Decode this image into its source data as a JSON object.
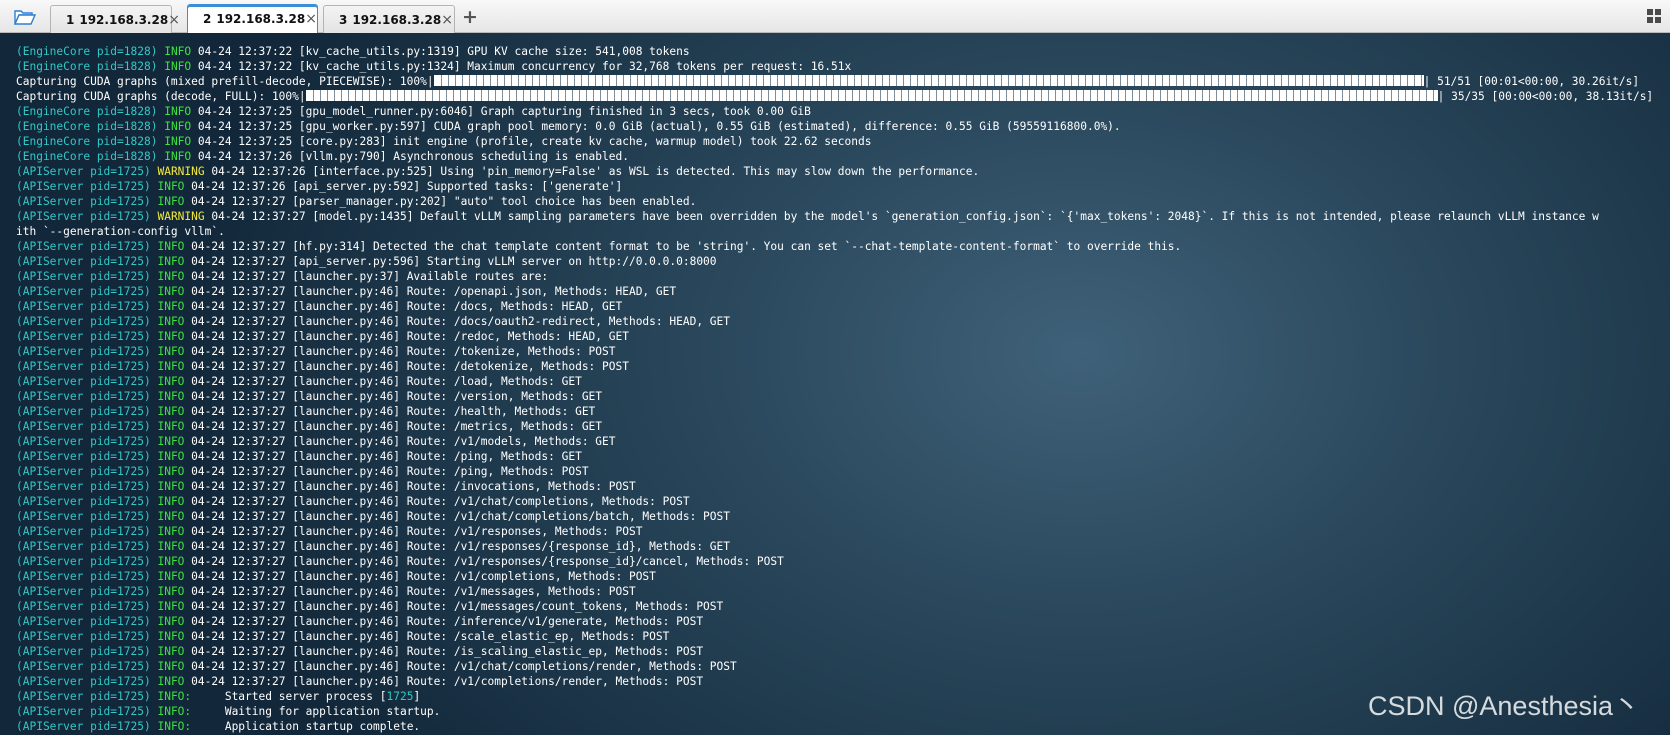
{
  "tabs": [
    {
      "number": "1",
      "host": "192.168.3.28",
      "active": false,
      "status_color": "#22c322"
    },
    {
      "number": "2",
      "host": "192.168.3.28",
      "active": true,
      "status_color": "#22c322"
    },
    {
      "number": "3",
      "host": "192.168.3.28",
      "active": false,
      "status_color": "#22c322"
    }
  ],
  "tabbar": {
    "close_glyph": "×",
    "new_tab_glyph": "+",
    "icons": [
      "folder-open-icon",
      "close-icon",
      "plus-icon",
      "grid-layout-icon"
    ]
  },
  "colors": {
    "prefix": "#33c7c7",
    "info": "#3de23d",
    "warning": "#f2e93a",
    "text": "#ffffff"
  },
  "terminal": {
    "lines": [
      {
        "prefix": "(EngineCore pid=1828)",
        "level": "INFO",
        "text": " 04-24 12:37:22 [kv_cache_utils.py:1319] GPU KV cache size: 541,008 tokens"
      },
      {
        "prefix": "(EngineCore pid=1828)",
        "level": "INFO",
        "text": " 04-24 12:37:22 [kv_cache_utils.py:1324] Maximum concurrency for 32,768 tokens per request: 16.51x"
      },
      {
        "pre": "Capturing CUDA graphs (mixed prefill-decode, PIECEWISE): 100%|",
        "bar": "pbar",
        "post": "| 51/51 [00:01<00:00, 30.26it/s]",
        "progress": 1.0
      },
      {
        "pre": "Capturing CUDA graphs (decode, FULL): 100%|",
        "bar": "pbar pbar2",
        "post": "| 35/35 [00:00<00:00, 38.13it/s]",
        "progress": 1.0
      },
      {
        "prefix": "(EngineCore pid=1828)",
        "level": "INFO",
        "text": " 04-24 12:37:25 [gpu_model_runner.py:6046] Graph capturing finished in 3 secs, took 0.00 GiB"
      },
      {
        "prefix": "(EngineCore pid=1828)",
        "level": "INFO",
        "text": " 04-24 12:37:25 [gpu_worker.py:597] CUDA graph pool memory: 0.0 GiB (actual), 0.55 GiB (estimated), difference: 0.55 GiB (59559116800.0%)."
      },
      {
        "prefix": "(EngineCore pid=1828)",
        "level": "INFO",
        "text": " 04-24 12:37:25 [core.py:283] init engine (profile, create kv cache, warmup model) took 22.62 seconds"
      },
      {
        "prefix": "(EngineCore pid=1828)",
        "level": "INFO",
        "text": " 04-24 12:37:26 [vllm.py:790] Asynchronous scheduling is enabled."
      },
      {
        "prefix": "(APIServer pid=1725)",
        "level": "WARNING",
        "text": " 04-24 12:37:26 [interface.py:525] Using 'pin_memory=False' as WSL is detected. This may slow down the performance."
      },
      {
        "prefix": "(APIServer pid=1725)",
        "level": "INFO",
        "text": " 04-24 12:37:26 [api_server.py:592] Supported tasks: ['generate']"
      },
      {
        "prefix": "(APIServer pid=1725)",
        "level": "INFO",
        "text": " 04-24 12:37:27 [parser_manager.py:202] \"auto\" tool choice has been enabled."
      },
      {
        "prefix": "(APIServer pid=1725)",
        "level": "WARNING",
        "text": " 04-24 12:37:27 [model.py:1435] Default vLLM sampling parameters have been overridden by the model's `generation_config.json`: `{'max_tokens': 2048}`. If this is not intended, please relaunch vLLM instance w"
      },
      {
        "text": "ith `--generation-config vllm`."
      },
      {
        "prefix": "(APIServer pid=1725)",
        "level": "INFO",
        "text": " 04-24 12:37:27 [hf.py:314] Detected the chat template content format to be 'string'. You can set `--chat-template-content-format` to override this."
      },
      {
        "prefix": "(APIServer pid=1725)",
        "level": "INFO",
        "text": " 04-24 12:37:27 [api_server.py:596] Starting vLLM server on http://0.0.0.0:8000"
      },
      {
        "prefix": "(APIServer pid=1725)",
        "level": "INFO",
        "text": " 04-24 12:37:27 [launcher.py:37] Available routes are:"
      },
      {
        "prefix": "(APIServer pid=1725)",
        "level": "INFO",
        "text": " 04-24 12:37:27 [launcher.py:46] Route: /openapi.json, Methods: HEAD, GET"
      },
      {
        "prefix": "(APIServer pid=1725)",
        "level": "INFO",
        "text": " 04-24 12:37:27 [launcher.py:46] Route: /docs, Methods: HEAD, GET"
      },
      {
        "prefix": "(APIServer pid=1725)",
        "level": "INFO",
        "text": " 04-24 12:37:27 [launcher.py:46] Route: /docs/oauth2-redirect, Methods: HEAD, GET"
      },
      {
        "prefix": "(APIServer pid=1725)",
        "level": "INFO",
        "text": " 04-24 12:37:27 [launcher.py:46] Route: /redoc, Methods: HEAD, GET"
      },
      {
        "prefix": "(APIServer pid=1725)",
        "level": "INFO",
        "text": " 04-24 12:37:27 [launcher.py:46] Route: /tokenize, Methods: POST"
      },
      {
        "prefix": "(APIServer pid=1725)",
        "level": "INFO",
        "text": " 04-24 12:37:27 [launcher.py:46] Route: /detokenize, Methods: POST"
      },
      {
        "prefix": "(APIServer pid=1725)",
        "level": "INFO",
        "text": " 04-24 12:37:27 [launcher.py:46] Route: /load, Methods: GET"
      },
      {
        "prefix": "(APIServer pid=1725)",
        "level": "INFO",
        "text": " 04-24 12:37:27 [launcher.py:46] Route: /version, Methods: GET"
      },
      {
        "prefix": "(APIServer pid=1725)",
        "level": "INFO",
        "text": " 04-24 12:37:27 [launcher.py:46] Route: /health, Methods: GET"
      },
      {
        "prefix": "(APIServer pid=1725)",
        "level": "INFO",
        "text": " 04-24 12:37:27 [launcher.py:46] Route: /metrics, Methods: GET"
      },
      {
        "prefix": "(APIServer pid=1725)",
        "level": "INFO",
        "text": " 04-24 12:37:27 [launcher.py:46] Route: /v1/models, Methods: GET"
      },
      {
        "prefix": "(APIServer pid=1725)",
        "level": "INFO",
        "text": " 04-24 12:37:27 [launcher.py:46] Route: /ping, Methods: GET"
      },
      {
        "prefix": "(APIServer pid=1725)",
        "level": "INFO",
        "text": " 04-24 12:37:27 [launcher.py:46] Route: /ping, Methods: POST"
      },
      {
        "prefix": "(APIServer pid=1725)",
        "level": "INFO",
        "text": " 04-24 12:37:27 [launcher.py:46] Route: /invocations, Methods: POST"
      },
      {
        "prefix": "(APIServer pid=1725)",
        "level": "INFO",
        "text": " 04-24 12:37:27 [launcher.py:46] Route: /v1/chat/completions, Methods: POST"
      },
      {
        "prefix": "(APIServer pid=1725)",
        "level": "INFO",
        "text": " 04-24 12:37:27 [launcher.py:46] Route: /v1/chat/completions/batch, Methods: POST"
      },
      {
        "prefix": "(APIServer pid=1725)",
        "level": "INFO",
        "text": " 04-24 12:37:27 [launcher.py:46] Route: /v1/responses, Methods: POST"
      },
      {
        "prefix": "(APIServer pid=1725)",
        "level": "INFO",
        "text": " 04-24 12:37:27 [launcher.py:46] Route: /v1/responses/{response_id}, Methods: GET"
      },
      {
        "prefix": "(APIServer pid=1725)",
        "level": "INFO",
        "text": " 04-24 12:37:27 [launcher.py:46] Route: /v1/responses/{response_id}/cancel, Methods: POST"
      },
      {
        "prefix": "(APIServer pid=1725)",
        "level": "INFO",
        "text": " 04-24 12:37:27 [launcher.py:46] Route: /v1/completions, Methods: POST"
      },
      {
        "prefix": "(APIServer pid=1725)",
        "level": "INFO",
        "text": " 04-24 12:37:27 [launcher.py:46] Route: /v1/messages, Methods: POST"
      },
      {
        "prefix": "(APIServer pid=1725)",
        "level": "INFO",
        "text": " 04-24 12:37:27 [launcher.py:46] Route: /v1/messages/count_tokens, Methods: POST"
      },
      {
        "prefix": "(APIServer pid=1725)",
        "level": "INFO",
        "text": " 04-24 12:37:27 [launcher.py:46] Route: /inference/v1/generate, Methods: POST"
      },
      {
        "prefix": "(APIServer pid=1725)",
        "level": "INFO",
        "text": " 04-24 12:37:27 [launcher.py:46] Route: /scale_elastic_ep, Methods: POST"
      },
      {
        "prefix": "(APIServer pid=1725)",
        "level": "INFO",
        "text": " 04-24 12:37:27 [launcher.py:46] Route: /is_scaling_elastic_ep, Methods: POST"
      },
      {
        "prefix": "(APIServer pid=1725)",
        "level": "INFO",
        "text": " 04-24 12:37:27 [launcher.py:46] Route: /v1/chat/completions/render, Methods: POST"
      },
      {
        "prefix": "(APIServer pid=1725)",
        "level": "INFO",
        "text": " 04-24 12:37:27 [launcher.py:46] Route: /v1/completions/render, Methods: POST"
      },
      {
        "prefix": "(APIServer pid=1725)",
        "level": "INFO:",
        "text": "     Started server process [",
        "pid": "1725",
        "tail": "]"
      },
      {
        "prefix": "(APIServer pid=1725)",
        "level": "INFO:",
        "text": "     Waiting for application startup."
      },
      {
        "prefix": "(APIServer pid=1725)",
        "level": "INFO:",
        "text": "     Application startup complete."
      }
    ]
  },
  "watermark": "CSDN @Anesthesia丶"
}
